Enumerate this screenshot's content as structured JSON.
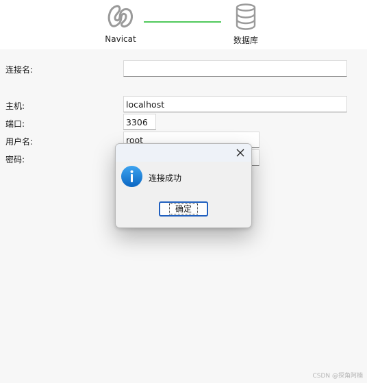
{
  "header": {
    "source_label": "Navicat",
    "target_label": "数据库",
    "connector_color": "#4fc95a",
    "source_icon": "navicat-logo-icon",
    "target_icon": "database-icon"
  },
  "form": {
    "connection_name_label": "连接名:",
    "connection_name_value": "",
    "host_label": "主机:",
    "host_value": "localhost",
    "port_label": "端口:",
    "port_value": "3306",
    "username_label": "用户名:",
    "username_value": "root",
    "password_label": "密码:",
    "password_value": ""
  },
  "dialog": {
    "icon": "info-icon",
    "message": "连接成功",
    "ok_label": "确定",
    "close_icon": "close-icon",
    "accent_color": "#1f5fbf"
  },
  "watermark": "CSDN @探角阿楠"
}
